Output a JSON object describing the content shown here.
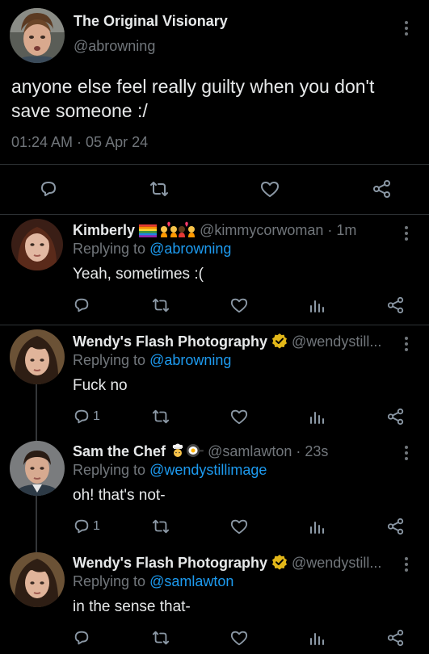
{
  "main_tweet": {
    "display_name": "The Original Visionary",
    "handle": "@abrowning",
    "text_line1": "anyone else feel really guilty when you don't",
    "text_line2": "save someone :/",
    "timestamp": "01:24 AM · 05 Apr 24"
  },
  "replies": [
    {
      "display_name": "Kimberly",
      "handle": "@kimmycorwoman · 1m",
      "replying_prefix": "Replying to",
      "replying_to": "@abrowning",
      "text": "Yeah, sometimes :(",
      "reply_count": ""
    },
    {
      "display_name": "Wendy's Flash Photography",
      "handle": "@wendystill...",
      "replying_prefix": "Replying to",
      "replying_to": "@abrowning",
      "text": "Fuck no",
      "reply_count": "1"
    },
    {
      "display_name": "Sam the Chef",
      "handle": "@samlawton · 23s",
      "replying_prefix": "Replying to",
      "replying_to": "@wendystillimage",
      "text": "oh! that's not-",
      "reply_count": "1"
    },
    {
      "display_name": "Wendy's Flash Photography",
      "handle": "@wendystill...",
      "replying_prefix": "Replying to",
      "replying_to": "@samlawton",
      "text": "in the sense that-",
      "reply_count": ""
    }
  ],
  "colors": {
    "background": "#000000",
    "text": "#e7e9ea",
    "muted": "#71767b",
    "link": "#1d9bf0",
    "verified": "#e2b719"
  },
  "icons": [
    "reply-icon",
    "retweet-icon",
    "like-icon",
    "share-icon",
    "views-icon",
    "more-icon",
    "verified-badge-icon"
  ]
}
